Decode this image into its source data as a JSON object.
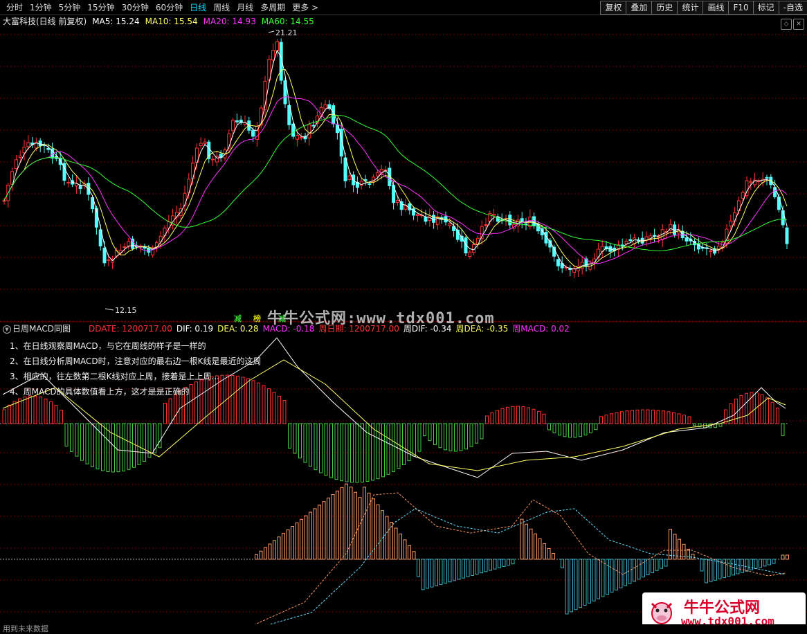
{
  "toolbar": {
    "periods": [
      "分时",
      "1分钟",
      "5分钟",
      "15分钟",
      "30分钟",
      "60分钟",
      "日线",
      "周线",
      "月线",
      "多周期",
      "更多 >"
    ],
    "active_period": "日线",
    "tools": [
      "复权",
      "叠加",
      "历史",
      "统计",
      "画线",
      "F10",
      "标记",
      "-自选"
    ]
  },
  "main_chart": {
    "title": "大富科技(日线 前复权)",
    "ma": [
      {
        "label": "MA5: 15.24",
        "color": "#ffffff"
      },
      {
        "label": "MA10: 15.54",
        "color": "#ffff66"
      },
      {
        "label": "MA20: 14.93",
        "color": "#ff33ff"
      },
      {
        "label": "MA60: 14.55",
        "color": "#33ff33"
      }
    ],
    "high_label": "21.21",
    "low_label": "12.15",
    "signals": [
      {
        "text": "减",
        "color": "#33cc33"
      },
      {
        "text": "榜",
        "color": "#cccc00"
      },
      {
        "text": "减",
        "color": "#33cc33"
      }
    ]
  },
  "watermark": "牛牛公式网:www.tdx001.com",
  "sub_chart": {
    "title": "日周MACD同图",
    "values": [
      {
        "label": "DDATE: 1200717.00",
        "color": "#ff3333"
      },
      {
        "label": "DIF: 0.19",
        "color": "#ffffff"
      },
      {
        "label": "DEA: 0.28",
        "color": "#ffff66"
      },
      {
        "label": "MACD: -0.18",
        "color": "#ff33ff"
      },
      {
        "label": "周日期: 1200717.00",
        "color": "#ff3333"
      },
      {
        "label": "周DIF: -0.34",
        "color": "#ffffff"
      },
      {
        "label": "周DEA: -0.35",
        "color": "#ffff66"
      },
      {
        "label": "周MACD: 0.02",
        "color": "#ff33ff"
      }
    ],
    "notes": [
      "1、在日线观察周MACD，与它在周线的样子是一样的",
      "2、在日线分析周MACD时，注意对应的最右边一根K线是最近的这周",
      "3、相应的，往左数第二根K线对应上周，接着是上上周...",
      "4、周MACD的具体数值看上方，这才是是正确的"
    ]
  },
  "brand": {
    "title": "牛牛公式网",
    "url": "www.tdx001.com"
  },
  "status_text": "用到未来数据",
  "colors": {
    "up": "#ff3232",
    "down": "#54ffff",
    "grid": "#7a0000",
    "ma5": "#ffffff",
    "ma10": "#ffff66",
    "ma20": "#ff33ff",
    "ma60": "#33ff33",
    "week_up": "#ff9966",
    "week_down": "#3ab0c0"
  }
}
